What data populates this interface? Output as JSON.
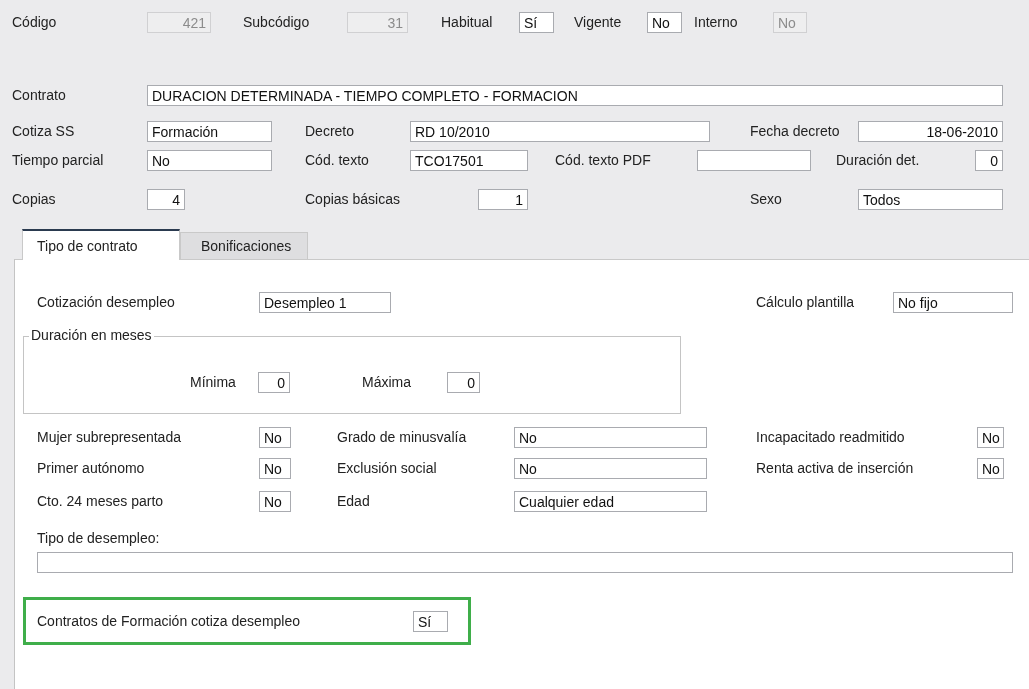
{
  "header_rows": [
    [
      {
        "kind": "label",
        "text": "Código"
      },
      {
        "kind": "number-field",
        "value": "421",
        "disabled": true
      },
      {
        "kind": "label",
        "text": "Subcódigo"
      },
      {
        "kind": "number-field",
        "value": "31",
        "disabled": true
      },
      {
        "kind": "label",
        "text": "Habitual"
      },
      {
        "kind": "text-field",
        "value": "Sí",
        "disabled": false
      },
      {
        "kind": "label",
        "text": "Vigente"
      },
      {
        "kind": "text-field",
        "value": "No",
        "disabled": false
      },
      {
        "kind": "label",
        "text": "Interno"
      },
      {
        "kind": "text-field",
        "value": "No",
        "disabled": true
      }
    ],
    [
      {
        "kind": "label",
        "text": "Contrato"
      },
      {
        "kind": "text-field",
        "value": "DURACION DETERMINADA - TIEMPO COMPLETO - FORMACION",
        "disabled": false
      }
    ],
    [
      {
        "kind": "label",
        "text": "Cotiza SS"
      },
      {
        "kind": "text-field",
        "value": "Formación",
        "disabled": false
      },
      {
        "kind": "label",
        "text": "Decreto"
      },
      {
        "kind": "text-field",
        "value": "RD 10/2010",
        "disabled": false
      },
      {
        "kind": "label",
        "text": "Fecha decreto"
      },
      {
        "kind": "number-field",
        "value": "18-06-2010",
        "disabled": false
      }
    ],
    [
      {
        "kind": "label",
        "text": "Tiempo parcial"
      },
      {
        "kind": "text-field",
        "value": "No",
        "disabled": false
      },
      {
        "kind": "label",
        "text": "Cód. texto"
      },
      {
        "kind": "text-field",
        "value": "TCO17501",
        "disabled": false
      },
      {
        "kind": "label",
        "text": "Cód. texto PDF"
      },
      {
        "kind": "text-field",
        "disabled": false
      },
      {
        "kind": "label",
        "text": "Duración det."
      },
      {
        "kind": "number-field",
        "value": "0",
        "disabled": false
      }
    ],
    [
      {
        "kind": "label",
        "text": "Copias"
      },
      {
        "kind": "number-field",
        "value": "4",
        "disabled": false
      },
      {
        "kind": "label",
        "text": "Copias básicas"
      },
      {
        "kind": "number-field",
        "value": "1",
        "disabled": false
      },
      {
        "kind": "label",
        "text": "Sexo"
      },
      {
        "kind": "text-field",
        "value": "Todos",
        "disabled": false
      }
    ]
  ],
  "tabs": [
    {
      "label": "Tipo de contrato",
      "selected": true
    },
    {
      "label": "Bonificaciones",
      "selected": false
    }
  ],
  "tab_panel": {
    "top_row": [
      {
        "kind": "label",
        "text": "Cotización desempleo"
      },
      {
        "kind": "text-field",
        "value": "Desempleo 1",
        "disabled": false
      },
      {
        "kind": "label",
        "text": "Cálculo plantilla"
      },
      {
        "kind": "text-field",
        "value": "No fijo",
        "disabled": false
      }
    ],
    "duration_group": {
      "legend": "Duración en meses",
      "items": [
        {
          "kind": "label",
          "text": "Mínima"
        },
        {
          "kind": "number-field",
          "value": "0",
          "disabled": false
        },
        {
          "kind": "label",
          "text": "Máxima"
        },
        {
          "kind": "number-field",
          "value": "0",
          "disabled": false
        }
      ]
    },
    "flag_rows": [
      [
        {
          "kind": "label",
          "text": "Mujer subrepresentada"
        },
        {
          "kind": "text-field",
          "value": "No",
          "disabled": false
        },
        {
          "kind": "label",
          "text": "Grado de minusvalía"
        },
        {
          "kind": "text-field",
          "value": "No",
          "disabled": false
        },
        {
          "kind": "label",
          "text": "Incapacitado readmitido"
        },
        {
          "kind": "text-field",
          "value": "No",
          "disabled": false
        }
      ],
      [
        {
          "kind": "label",
          "text": "Primer autónomo"
        },
        {
          "kind": "text-field",
          "value": "No",
          "disabled": false
        },
        {
          "kind": "label",
          "text": "Exclusión social"
        },
        {
          "kind": "text-field",
          "value": "No",
          "disabled": false
        },
        {
          "kind": "label",
          "text": "Renta activa de inserción"
        },
        {
          "kind": "text-field",
          "value": "No",
          "disabled": false
        }
      ],
      [
        {
          "kind": "label",
          "text": "Cto. 24 meses parto"
        },
        {
          "kind": "text-field",
          "value": "No",
          "disabled": false
        },
        {
          "kind": "label",
          "text": "Edad"
        },
        {
          "kind": "text-field",
          "value": "Cualquier edad",
          "disabled": false
        }
      ]
    ],
    "unemployment_type": {
      "label": "Tipo de desempleo:"
    },
    "highlight": [
      {
        "kind": "label",
        "text": "Contratos de Formación cotiza desempleo"
      },
      {
        "kind": "text-field",
        "value": "Sí",
        "disabled": false
      }
    ]
  }
}
